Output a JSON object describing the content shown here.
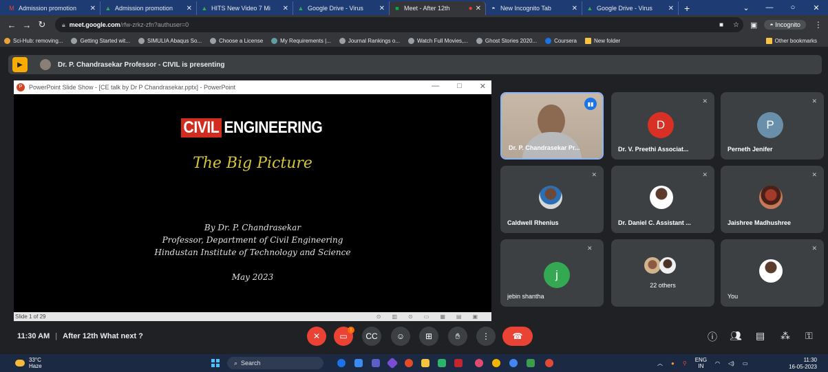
{
  "browser": {
    "tabs": [
      {
        "label": "Admission promotion",
        "icon": "gmail-icon",
        "color": "#ea4335"
      },
      {
        "label": "Admission promotion",
        "icon": "drive-icon",
        "color": "#34a853"
      },
      {
        "label": "HITS New Video 7 Mi",
        "icon": "drive-icon",
        "color": "#34a853"
      },
      {
        "label": "Google Drive - Virus",
        "icon": "drive-icon",
        "color": "#34a853"
      },
      {
        "label": "Meet - After 12th",
        "icon": "meet-icon",
        "color": "#00832d"
      },
      {
        "label": "New Incognito Tab",
        "icon": "incognito-icon",
        "color": "#9aa0a6"
      },
      {
        "label": "Google Drive - Virus",
        "icon": "drive-icon",
        "color": "#34a853"
      }
    ],
    "url_host": "meet.google.com",
    "url_path": "/rfw-zrkz-zfn?authuser=0",
    "incognito_label": "Incognito",
    "bookmarks": [
      "Sci-Hub: removing...",
      "Getting Started wit...",
      "SIMULIA Abaqus So...",
      "Choose a License",
      "My Requirements |...",
      "Journal Rankings o...",
      "Watch Full Movies,...",
      "Ghost Stories 2020...",
      "Coursera",
      "New folder"
    ],
    "other_bookmarks": "Other bookmarks"
  },
  "meet": {
    "presenting_text": "Dr. P. Chandrasekar Professor - CIVIL is presenting",
    "time": "11:30 AM",
    "meeting_title": "After 12th What next ?",
    "chat_badge": "!",
    "participants": [
      {
        "name": "Dr. P. Chandrasekar Pr...",
        "kind": "camera"
      },
      {
        "name": "Dr. V. Preethi Associat...",
        "initial": "D",
        "color": "#d93025"
      },
      {
        "name": "Perneth Jenifer",
        "initial": "P",
        "color": "#6a8fab"
      },
      {
        "name": "Caldwell Rhenius",
        "kind": "photo"
      },
      {
        "name": "Dr. Daniel C. Assistant ...",
        "kind": "photo"
      },
      {
        "name": "Jaishree Madhushree",
        "kind": "photo"
      },
      {
        "name": "jebin shantha",
        "initial": "j",
        "color": "#34a853"
      },
      {
        "name": "22 others",
        "kind": "group"
      },
      {
        "name": "You",
        "kind": "photo"
      }
    ]
  },
  "ppt": {
    "window_title": "PowerPoint Slide Show - [CE talk by Dr P Chandrasekar.pptx] - PowerPoint",
    "heading_a": "CIVIL",
    "heading_b": "ENGINEERING",
    "subtitle": "The Big Picture",
    "by_line": "By Dr. P. Chandrasekar",
    "role_line": "Professor, Department of Civil Engineering",
    "inst_line": "Hindustan Institute of Technology and Science",
    "date_line": "May 2023",
    "slide_counter": "Slide 1 of 29"
  },
  "taskbar": {
    "temp": "33°C",
    "weather": "Haze",
    "search_label": "Search",
    "lang_top": "ENG",
    "lang_bottom": "IN",
    "clock_time": "11:30",
    "clock_date": "16-05-2023"
  }
}
